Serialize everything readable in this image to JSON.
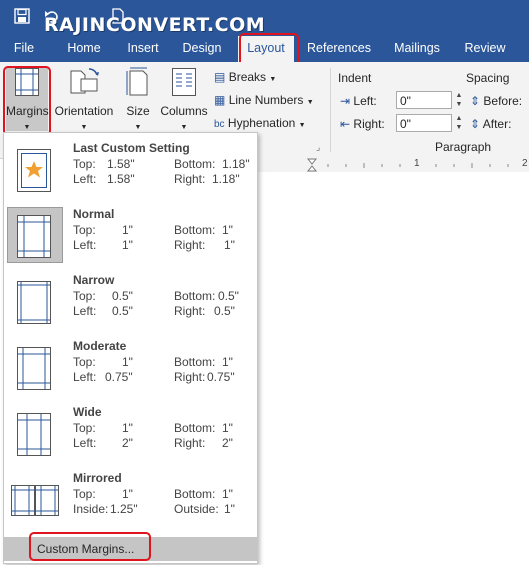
{
  "watermark": "RAJINCONVERT.COM",
  "tabs": [
    {
      "label": "File"
    },
    {
      "label": "Home"
    },
    {
      "label": "Insert"
    },
    {
      "label": "Design"
    },
    {
      "label": "Layout"
    },
    {
      "label": "References"
    },
    {
      "label": "Mailings"
    },
    {
      "label": "Review"
    }
  ],
  "ribbon": {
    "margins_label": "Margins",
    "orientation_label": "Orientation",
    "size_label": "Size",
    "columns_label": "Columns",
    "breaks_label": "Breaks",
    "line_numbers_label": "Line Numbers",
    "hyphenation_label": "Hyphenation",
    "indent_label": "Indent",
    "left_label": "Left:",
    "right_label": "Right:",
    "left_value": "0\"",
    "right_value": "0\"",
    "spacing_label": "Spacing",
    "before_label": "Before:",
    "after_label": "After:",
    "paragraph_label": "Paragraph"
  },
  "ruler": {
    "marks": [
      "1",
      "2"
    ]
  },
  "margins_menu": {
    "options": [
      {
        "title": "Last Custom Setting",
        "r1l": "Top:",
        "r1v": "1.58\"",
        "r1l2": "Bottom:",
        "r1v2": "1.18\"",
        "r2l": "Left:",
        "r2v": "1.58\"",
        "r2l2": "Right:",
        "r2v2": "1.18\""
      },
      {
        "title": "Normal",
        "r1l": "Top:",
        "r1v": "1\"",
        "r1l2": "Bottom:",
        "r1v2": "1\"",
        "r2l": "Left:",
        "r2v": "1\"",
        "r2l2": "Right:",
        "r2v2": "1\""
      },
      {
        "title": "Narrow",
        "r1l": "Top:",
        "r1v": "0.5\"",
        "r1l2": "Bottom:",
        "r1v2": "0.5\"",
        "r2l": "Left:",
        "r2v": "0.5\"",
        "r2l2": "Right:",
        "r2v2": "0.5\""
      },
      {
        "title": "Moderate",
        "r1l": "Top:",
        "r1v": "1\"",
        "r1l2": "Bottom:",
        "r1v2": "1\"",
        "r2l": "Left:",
        "r2v": "0.75\"",
        "r2l2": "Right:",
        "r2v2": "0.75\""
      },
      {
        "title": "Wide",
        "r1l": "Top:",
        "r1v": "1\"",
        "r1l2": "Bottom:",
        "r1v2": "1\"",
        "r2l": "Left:",
        "r2v": "2\"",
        "r2l2": "Right:",
        "r2v2": "2\""
      },
      {
        "title": "Mirrored",
        "r1l": "Top:",
        "r1v": "1\"",
        "r1l2": "Bottom:",
        "r1v2": "1\"",
        "r2l": "Inside:",
        "r2v": "1.25\"",
        "r2l2": "Outside:",
        "r2v2": "1\""
      }
    ],
    "custom_label": "Custom Margins..."
  },
  "colors": {
    "accent": "#2b579a",
    "highlight": "#e0141e",
    "selected": "#c5c5c5"
  }
}
